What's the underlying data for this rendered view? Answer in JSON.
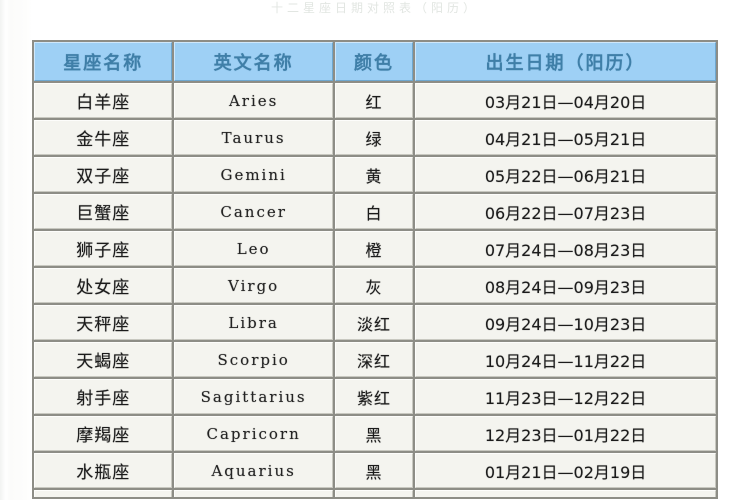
{
  "page": {
    "faint_top_text": "十二星座日期对照表（阳历）",
    "header_bg": "#9ed0f5",
    "header_text_color": "#3f7fa8",
    "cell_bg": "#f4f4ef",
    "grid_color": "#8d8d86"
  },
  "table": {
    "columns": [
      {
        "key": "name",
        "label": "星座名称"
      },
      {
        "key": "en",
        "label": "英文名称"
      },
      {
        "key": "color",
        "label": "颜色"
      },
      {
        "key": "date",
        "label": "出生日期（阳历）"
      }
    ],
    "rows": [
      {
        "name": "白羊座",
        "en": "Aries",
        "color": "红",
        "date": "03月21日—04月20日"
      },
      {
        "name": "金牛座",
        "en": "Taurus",
        "color": "绿",
        "date": "04月21日—05月21日"
      },
      {
        "name": "双子座",
        "en": "Gemini",
        "color": "黄",
        "date": "05月22日—06月21日"
      },
      {
        "name": "巨蟹座",
        "en": "Cancer",
        "color": "白",
        "date": "06月22日—07月23日"
      },
      {
        "name": "狮子座",
        "en": "Leo",
        "color": "橙",
        "date": "07月24日—08月23日"
      },
      {
        "name": "处女座",
        "en": "Virgo",
        "color": "灰",
        "date": "08月24日—09月23日"
      },
      {
        "name": "天秤座",
        "en": "Libra",
        "color": "淡红",
        "date": "09月24日—10月23日"
      },
      {
        "name": "天蝎座",
        "en": "Scorpio",
        "color": "深红",
        "date": "10月24日—11月22日"
      },
      {
        "name": "射手座",
        "en": "Sagittarius",
        "color": "紫红",
        "date": "11月23日—12月22日"
      },
      {
        "name": "摩羯座",
        "en": "Capricorn",
        "color": "黑",
        "date": "12月23日—01月22日"
      },
      {
        "name": "水瓶座",
        "en": "Aquarius",
        "color": "黑",
        "date": "01月21日—02月19日"
      }
    ]
  }
}
